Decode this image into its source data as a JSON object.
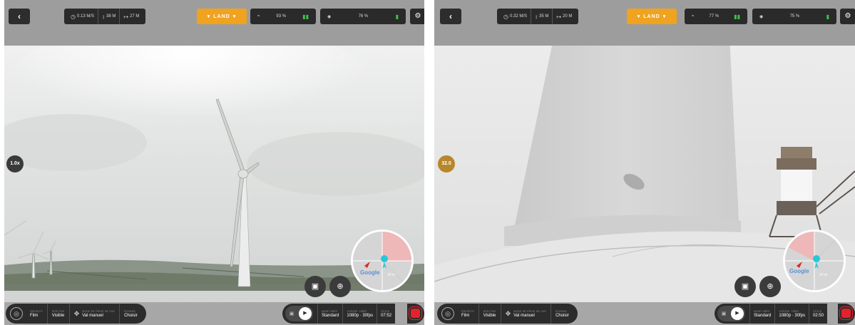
{
  "panels": [
    {
      "id": "left",
      "telemetry": {
        "speed": "0.13 M/S",
        "altitude": "38 M",
        "distance": "27 M"
      },
      "land_label": "LAND",
      "status": {
        "link": "93 %",
        "battery": "76 %"
      },
      "zoom": "1.0x",
      "minimap": {
        "google": "Google",
        "scale": "10 m"
      },
      "settings": {
        "preset": {
          "label": "PRESETS",
          "value": "Film"
        },
        "spectrum": {
          "label": "SPECTRE",
          "value": "Visible"
        },
        "mode": {
          "label": "MODE DE PRISE DE VUE",
          "value": "Val manuel"
        },
        "overlay": {
          "label": "ÉCRANS",
          "value": "Choisir"
        }
      },
      "capture": {
        "video_mode": {
          "label": "MODE VIDÉO",
          "value": "Standard"
        },
        "resolution": {
          "label": "VITESSE · DÉBIT",
          "value": "1080p · 30fps"
        },
        "time": {
          "label": "STOCK",
          "value": "07:52"
        }
      }
    },
    {
      "id": "right",
      "telemetry": {
        "speed": "0.32 M/S",
        "altitude": "35 M",
        "distance": "20 M"
      },
      "land_label": "LAND",
      "status": {
        "link": "77 %",
        "battery": "75 %"
      },
      "zoom": "32.0",
      "minimap": {
        "google": "Google",
        "scale": "10 m"
      },
      "settings": {
        "preset": {
          "label": "PRESETS",
          "value": "Film"
        },
        "spectrum": {
          "label": "SPECTRE",
          "value": "Visible"
        },
        "mode": {
          "label": "MODE DE PRISE DE VUE",
          "value": "Val manuel"
        },
        "overlay": {
          "label": "ÉCRANS",
          "value": "Choisir"
        }
      },
      "capture": {
        "video_mode": {
          "label": "MODE VIDÉO",
          "value": "Standard"
        },
        "resolution": {
          "label": "VITESSE · DÉBIT",
          "value": "1080p · 30fps"
        },
        "time": {
          "label": "STOCK",
          "value": "02:50"
        }
      }
    }
  ],
  "colors": {
    "land": "#f0a31f",
    "record": "#e5222b",
    "status_green": "#3fc14a",
    "bar_dark": "#2a2a2a"
  },
  "icons": [
    "back-arrow-icon",
    "speed-icon",
    "altitude-icon",
    "distance-icon",
    "wifi-icon",
    "signal-icon",
    "battery-icon",
    "eye-icon",
    "gear-icon",
    "camera-icon",
    "target-icon",
    "film-icon",
    "photo-icon",
    "video-icon",
    "drone-icon",
    "record-icon"
  ]
}
